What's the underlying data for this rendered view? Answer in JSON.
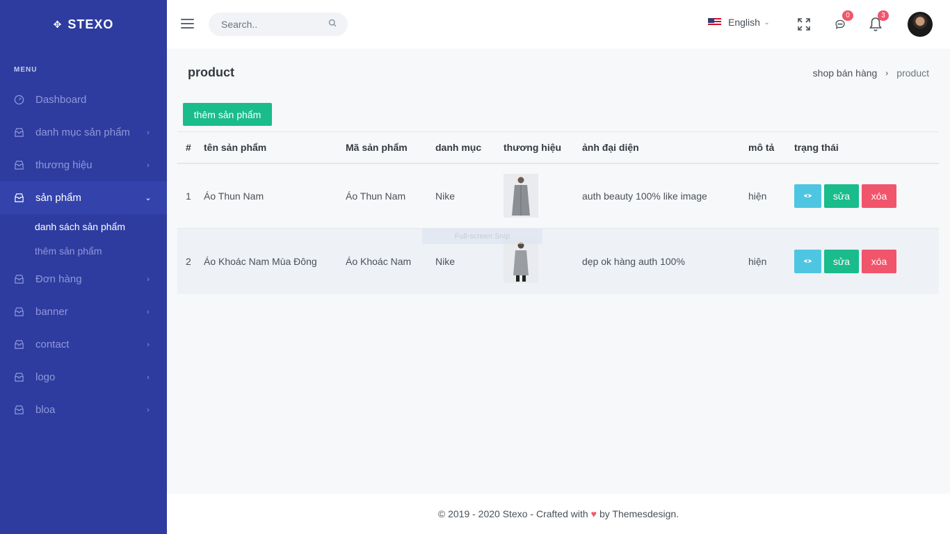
{
  "sidebar": {
    "brand": "STEXO",
    "menu_title": "MENU",
    "items": [
      {
        "label": "Dashboard"
      },
      {
        "label": "danh mục sản phẩm"
      },
      {
        "label": "thương hiệu"
      },
      {
        "label": "sản phẩm"
      },
      {
        "label": "Đơn hàng"
      },
      {
        "label": "banner"
      },
      {
        "label": "contact"
      },
      {
        "label": "logo"
      },
      {
        "label": "bloa"
      }
    ],
    "sub_items": [
      {
        "label": "danh sách sản phẩm"
      },
      {
        "label": "thêm sản phẩm"
      }
    ]
  },
  "topbar": {
    "search_placeholder": "Search..",
    "language": "English",
    "messages_count": "0",
    "notifications_count": "3"
  },
  "page": {
    "title": "product",
    "breadcrumb": [
      "shop bán hàng",
      "product"
    ],
    "add_button": "thêm sản phẩm"
  },
  "table": {
    "headers": [
      "#",
      "tên sản phẩm",
      "Mã sản phẩm",
      "danh mục",
      "thương hiệu",
      "ảnh đại diện",
      "mô tả",
      "trạng thái"
    ],
    "rows": [
      {
        "no": "1",
        "name": "Áo Thun Nam",
        "code": "Áo Thun Nam",
        "category": "Nike",
        "description": "auth beauty 100% like image",
        "status": "hiện",
        "edit": "sửa",
        "delete": "xóa"
      },
      {
        "no": "2",
        "name": "Áo Khoác Nam Mùa Đông",
        "code": "Áo Khoác Nam",
        "category": "Nike",
        "description": "dẹp ok hàng auth 100%",
        "status": "hiện",
        "edit": "sửa",
        "delete": "xóa"
      }
    ]
  },
  "overlay": {
    "text": "Full-screen Snip"
  },
  "footer": {
    "before": "© 2019 - 2020 Stexo - Crafted with",
    "after": "by Themesdesign."
  },
  "colors": {
    "sidebar_bg": "#2e3ca0",
    "success": "#1abc8c",
    "info": "#4fc6e1",
    "danger": "#f1556c"
  }
}
